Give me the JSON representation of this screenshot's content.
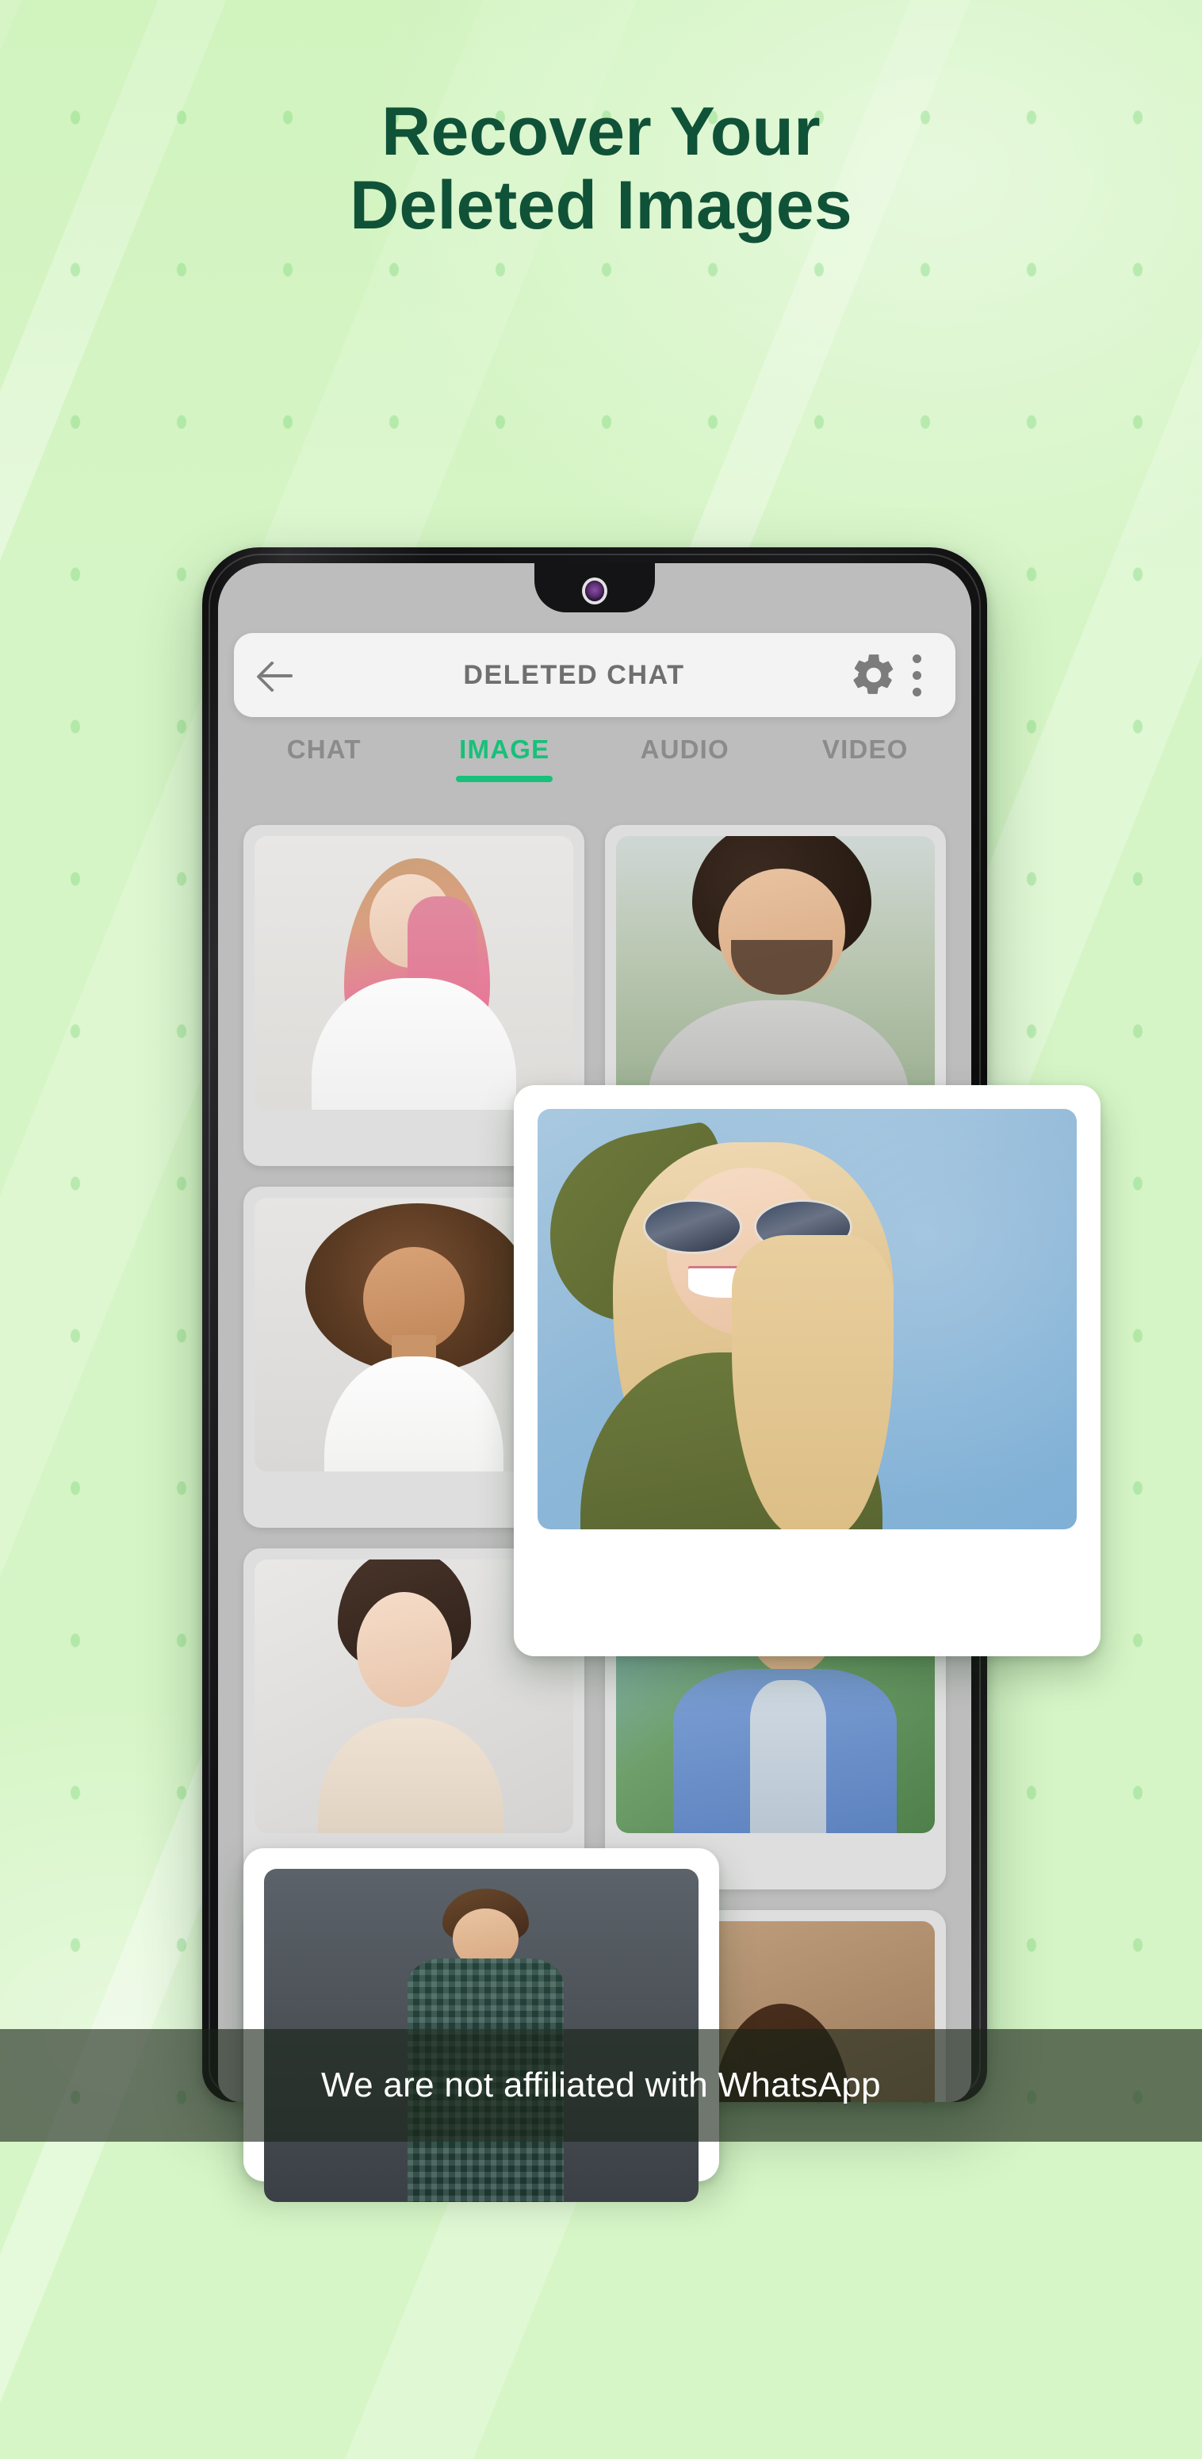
{
  "headline": {
    "line1": "Recover Your",
    "line2": "Deleted Images"
  },
  "colors": {
    "background": "#d6f5c6",
    "headline_text": "#0f5238",
    "accent_green": "#18c07a",
    "appbar_bg": "#f3f3f3",
    "appbar_text": "#6f6f6f",
    "tab_inactive": "#8b8b8b",
    "screen_bg": "#bdbdbd",
    "card_bg": "#dedede",
    "footer_overlay": "rgba(24,36,22,0.62)",
    "footer_text": "#ffffff"
  },
  "phone": {
    "appbar": {
      "back_icon": "back-arrow-icon",
      "title": "DELETED CHAT",
      "settings_icon": "gear-icon",
      "overflow_icon": "three-dot-menu-icon"
    },
    "tabs": [
      {
        "label": "CHAT",
        "active": false
      },
      {
        "label": "IMAGE",
        "active": true
      },
      {
        "label": "AUDIO",
        "active": false
      },
      {
        "label": "VIDEO",
        "active": false
      }
    ],
    "grid": [
      {
        "alt": "Smiling woman with pink ombre hair in white t-shirt"
      },
      {
        "alt": "Laughing man with curly dark hair outdoors"
      },
      {
        "alt": "Smiling woman with curly afro hair in white tank top"
      },
      {
        "alt": "Blurred photo thumbnail"
      },
      {
        "alt": "Smiling woman with dark updo hair"
      },
      {
        "alt": "Smiling man in blue shirt outdoors"
      },
      {
        "alt": "Partially visible photo thumbnail"
      },
      {
        "alt": "Partially visible photo thumbnail"
      }
    ]
  },
  "popups": [
    {
      "alt": "Blonde woman in sunglasses and olive sweater against a blue wall"
    },
    {
      "alt": "Smiling man in green plaid shirt against a dark grey wall"
    }
  ],
  "footer": {
    "disclaimer": "We are not affiliated with WhatsApp"
  }
}
